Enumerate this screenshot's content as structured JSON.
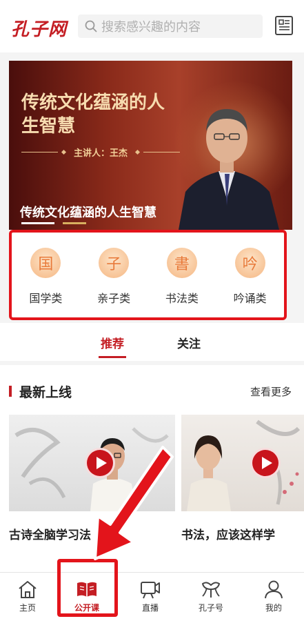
{
  "header": {
    "logo_text": "孔子网",
    "search_placeholder": "搜索感兴趣的内容",
    "icons": {
      "search": "search-icon",
      "message": "message-list-icon"
    }
  },
  "banner": {
    "headline": "传统文化蕴涵的人生智慧",
    "host": "主讲人：王杰",
    "caption": "传统文化蕴涵的人生智慧",
    "indicator_count": 2,
    "active_indicator": 1
  },
  "categories": [
    {
      "label": "国学类",
      "glyph": "国"
    },
    {
      "label": "亲子类",
      "glyph": "子"
    },
    {
      "label": "书法类",
      "glyph": "書"
    },
    {
      "label": "吟诵类",
      "glyph": "吟"
    }
  ],
  "tabs": [
    {
      "label": "推荐",
      "active": true
    },
    {
      "label": "关注",
      "active": false
    }
  ],
  "latest": {
    "title": "最新上线",
    "more": "查看更多",
    "cards": [
      {
        "title": "古诗全脑学习法"
      },
      {
        "title": "书法，应该这样学"
      }
    ]
  },
  "nav": {
    "items": [
      {
        "label": "主页",
        "icon": "home-icon"
      },
      {
        "label": "公开课",
        "icon": "open-book-icon",
        "active": true
      },
      {
        "label": "直播",
        "icon": "video-camera-icon"
      },
      {
        "label": "孔子号",
        "icon": "ginkgo-leaf-icon"
      },
      {
        "label": "我的",
        "icon": "user-icon"
      }
    ]
  },
  "colors": {
    "brand_red": "#c41e24",
    "highlight_red": "#e3141b",
    "category_circle": "#f7c294"
  }
}
